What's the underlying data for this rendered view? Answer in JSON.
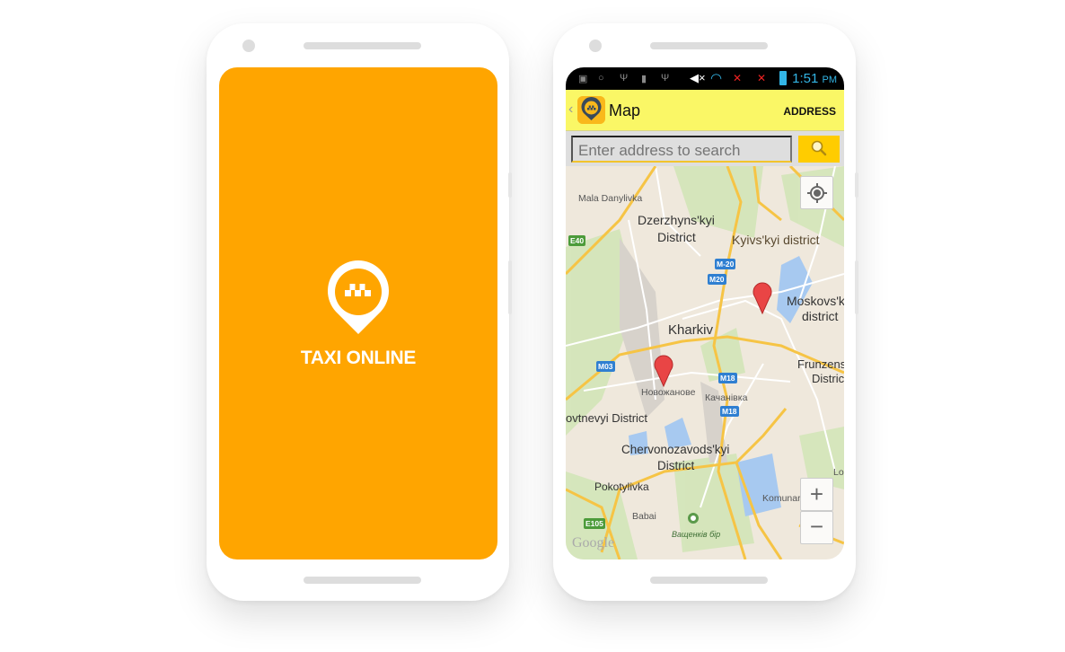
{
  "splash": {
    "brand": "TAXI ONLINE",
    "background": "#FFA500"
  },
  "status_bar": {
    "time": "1:51",
    "ampm": "PM",
    "icons": [
      "sim-icon",
      "sync-icon",
      "usb-icon",
      "debug-icon",
      "usb-icon",
      "mute-icon",
      "wifi-icon",
      "signal-1-icon",
      "signal-2-icon",
      "battery-icon"
    ]
  },
  "app_bar": {
    "title": "Map",
    "action": "ADDRESS",
    "background": "#FAF766"
  },
  "search": {
    "placeholder": "Enter address to search",
    "button_color": "#FFCC00"
  },
  "map": {
    "labels": {
      "mala_danylivka": "Mala Danylivka",
      "dzerzhynskyi": "Dzerzhyns'kyi",
      "district": "District",
      "kyivskyi": "Kyivs'kyi district",
      "moskovskyi": "Moskovs'k",
      "district_l": "district",
      "kharkiv": "Kharkiv",
      "frunzenskyi": "Frunzens",
      "distric": "Distric",
      "novozhanove": "Новожанове",
      "kachanivka": "Качанівка",
      "zhovtnevyi": "ovtnevyi District",
      "chervonozavodskyi": "Chervonozavods'kyi",
      "district2": "District",
      "pokotylivka": "Pokotylivka",
      "komunar": "Komunar",
      "babai": "Babai",
      "vashchenkiv": "Ващенків бір",
      "lo": "Lo",
      "google": "Google"
    },
    "shields": {
      "e40": "E40",
      "m20a": "M-20",
      "m20b": "M20",
      "m03": "M03",
      "m18a": "M18",
      "m18b": "M18",
      "e105": "E105"
    },
    "zoom_in": "+",
    "zoom_out": "−"
  }
}
